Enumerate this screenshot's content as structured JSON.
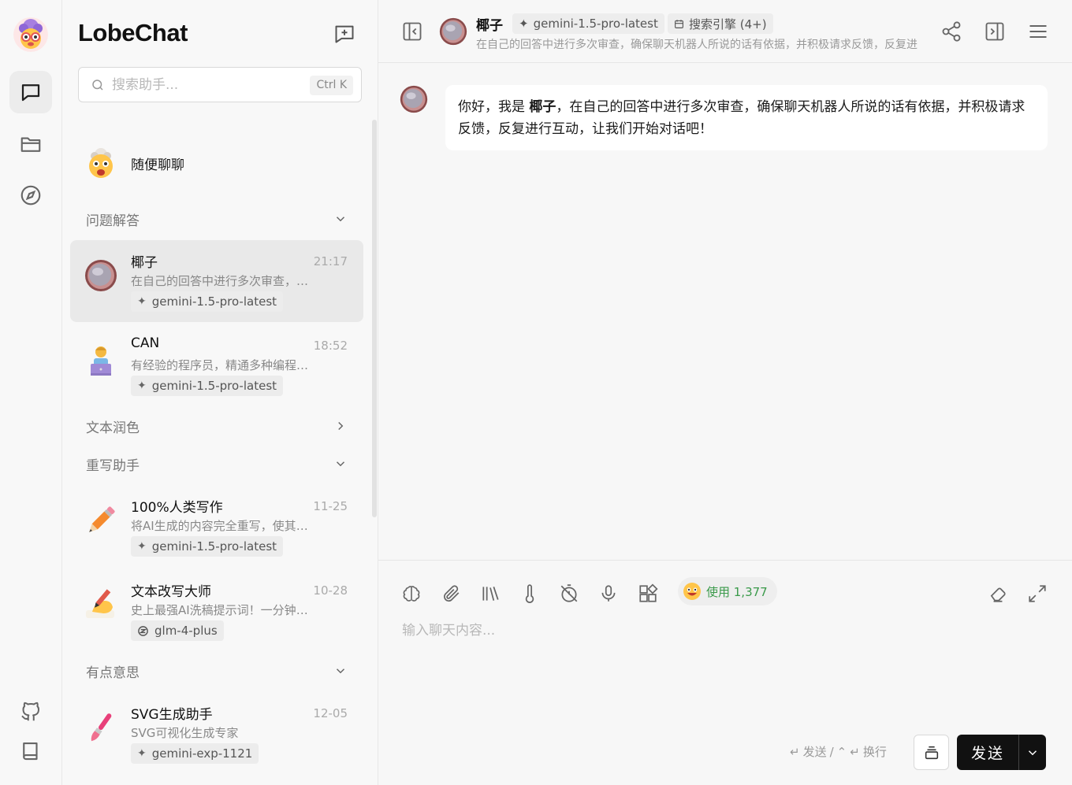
{
  "app": {
    "brand": "LobeChat"
  },
  "search": {
    "placeholder": "搜索助手...",
    "shortcut": "Ctrl K"
  },
  "inbox": {
    "name": "随便聊聊"
  },
  "groups": {
    "qa": "问题解答",
    "polish": "文本润色",
    "rewrite": "重写助手",
    "fun": "有点意思"
  },
  "sessions": [
    {
      "title": "椰子",
      "time": "21:17",
      "desc": "在自己的回答中进行多次审查，确保聊天机器人所说的话有依据",
      "model": "gemini-1.5-pro-latest",
      "avatar": "coconut"
    },
    {
      "title": "CAN",
      "time": "18:52",
      "desc": "有经验的程序员，精通多种编程语言",
      "model": "gemini-1.5-pro-latest",
      "avatar": "programmer"
    },
    {
      "title": "100%人类写作",
      "time": "11-25",
      "desc": "将AI生成的内容完全重写，使其读起来像人类写作",
      "model": "gemini-1.5-pro-latest",
      "avatar": "pencil"
    },
    {
      "title": "文本改写大师",
      "time": "10-28",
      "desc": "史上最强AI洗稿提示词！一分钟改写",
      "model": "glm-4-plus",
      "avatar": "writing-hand"
    },
    {
      "title": "SVG生成助手",
      "time": "12-05",
      "desc": "SVG可视化生成专家",
      "model": "gemini-exp-1121",
      "avatar": "paintbrush"
    }
  ],
  "header": {
    "title": "椰子",
    "model": "gemini-1.5-pro-latest",
    "plugin": "搜索引擎 (4+)",
    "desc": "在自己的回答中进行多次审查，确保聊天机器人所说的话有依据，并积极请求反馈，反复进行互动"
  },
  "message": {
    "pre": "你好，我是 ",
    "name": "椰子",
    "post": "，在自己的回答中进行多次审查，确保聊天机器人所说的话有依据，并积极请求反馈，反复进行互动，让我们开始对话吧！"
  },
  "composer": {
    "usage": "使用 1,377",
    "placeholder": "输入聊天内容...",
    "hint_send": "发送",
    "hint_sep": "/",
    "hint_newline": "换行",
    "send_label": "发送"
  },
  "colors": {
    "accent": "#111111",
    "active_bg": "#e9e9e9",
    "usage_text": "#3a9a4a"
  }
}
